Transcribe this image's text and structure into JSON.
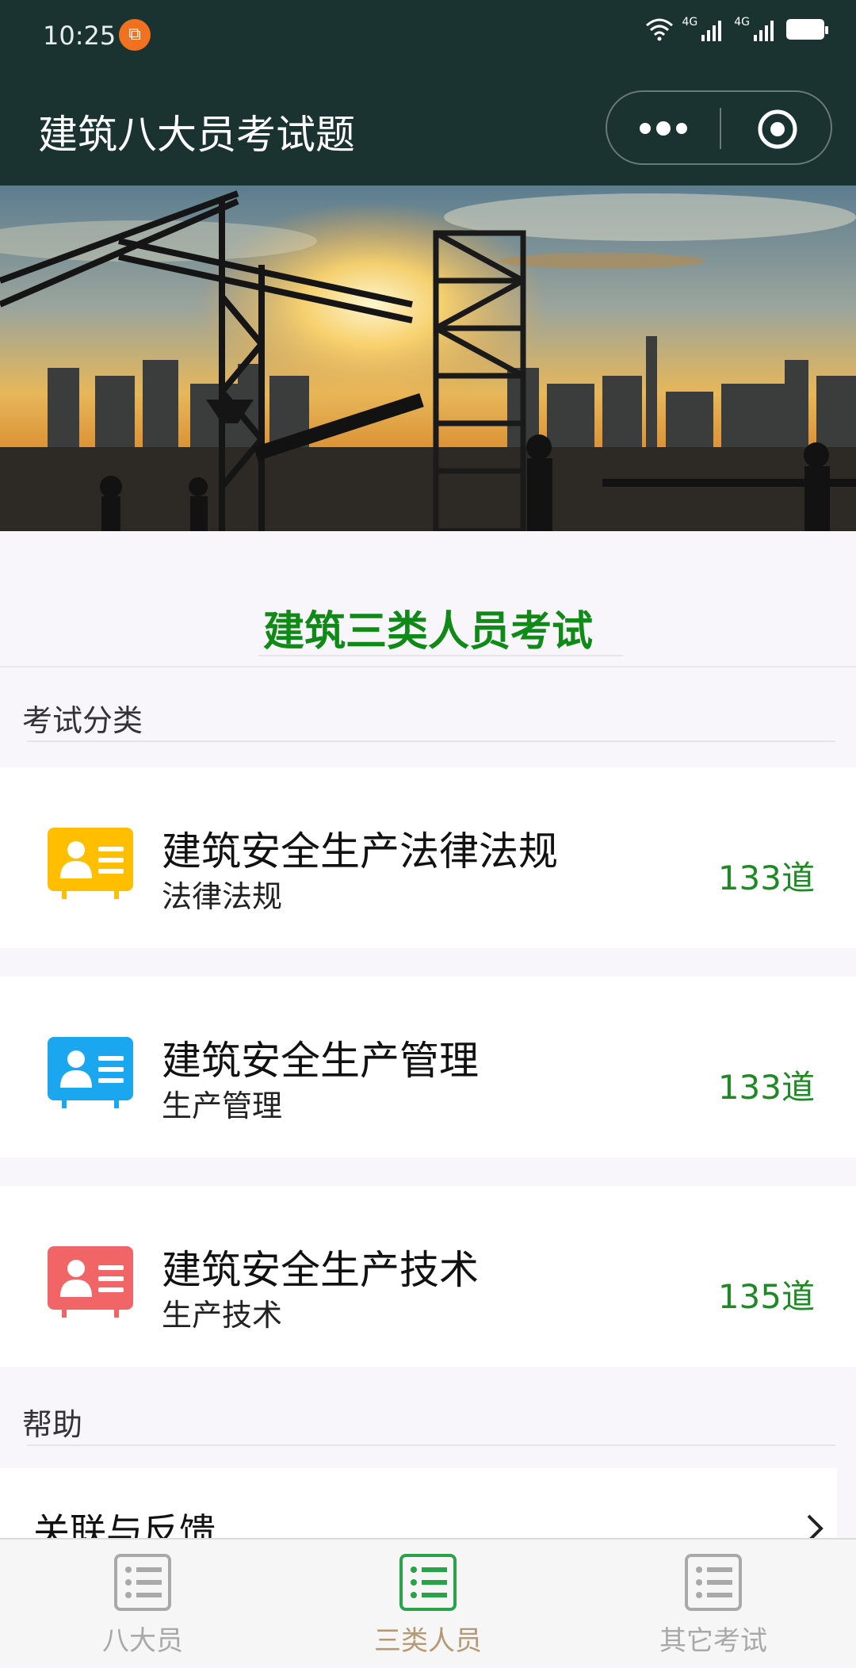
{
  "status_bar": {
    "time": "10:25",
    "network_labels": [
      "4G",
      "4G"
    ]
  },
  "nav": {
    "title": "建筑八大员考试题"
  },
  "main": {
    "heading": "建筑三类人员考试",
    "category_label": "考试分类",
    "items": [
      {
        "title": "建筑安全生产法律法规",
        "subtitle": "法律法规",
        "count": "133道",
        "icon_color": "#ffbf00"
      },
      {
        "title": "建筑安全生产管理",
        "subtitle": "生产管理",
        "count": "133道",
        "icon_color": "#1aa7f0"
      },
      {
        "title": "建筑安全生产技术",
        "subtitle": "生产技术",
        "count": "135道",
        "icon_color": "#f26566"
      }
    ],
    "help_label": "帮助",
    "help_item": "关联与反馈"
  },
  "tabs": [
    {
      "label": "八大员",
      "active": false
    },
    {
      "label": "三类人员",
      "active": true
    },
    {
      "label": "其它考试",
      "active": false
    }
  ],
  "colors": {
    "header_bg": "#1a3230",
    "heading_green": "#0f8a17",
    "count_green": "#1f8a25",
    "tab_active": "#2aa24a",
    "tab_active_label": "#b39a74",
    "tab_inactive": "#a9a9a9"
  }
}
